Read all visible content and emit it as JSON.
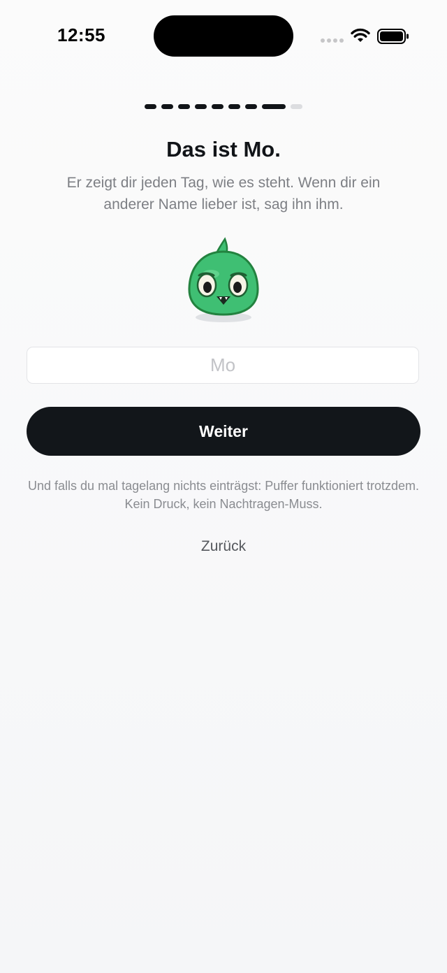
{
  "status_bar": {
    "time": "12:55",
    "icons": [
      "cellular-signal-icon",
      "wifi-icon",
      "battery-icon"
    ]
  },
  "progress": {
    "total_steps": 9,
    "current_step": 8
  },
  "content": {
    "title": "Das ist Mo.",
    "subtitle": "Er zeigt dir jeden Tag, wie es steht. Wenn dir ein anderer Name lieber ist, sag ihn ihm.",
    "mascot": "mascot-icon",
    "name_input": {
      "value": "",
      "placeholder": "Mo"
    },
    "continue_label": "Weiter",
    "hint": "Und falls du mal tagelang nichts einträgst: Puffer funktioniert trotzdem. Kein Druck, kein Nachtragen-Muss.",
    "back_label": "Zurück"
  },
  "colors": {
    "primary_button": "#12161a",
    "progress_active": "#111418",
    "progress_inactive": "#dcdde0",
    "mascot_green": "#3fbf73"
  }
}
